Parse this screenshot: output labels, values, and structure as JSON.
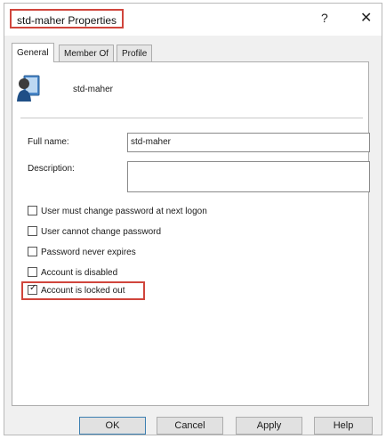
{
  "window": {
    "title": "std-maher Properties",
    "help_glyph": "?",
    "close_glyph": "✕"
  },
  "tabs": [
    {
      "label": "General",
      "active": true
    },
    {
      "label": "Member Of",
      "active": false
    },
    {
      "label": "Profile",
      "active": false
    }
  ],
  "user": {
    "display_name": "std-maher",
    "icon": "user-account-icon"
  },
  "form": {
    "full_name_label": "Full name:",
    "full_name_value": "std-maher",
    "description_label": "Description:",
    "description_value": ""
  },
  "checkboxes": [
    {
      "label": "User must change password at next logon",
      "checked": false
    },
    {
      "label": "User cannot change password",
      "checked": false
    },
    {
      "label": "Password never expires",
      "checked": false
    },
    {
      "label": "Account is disabled",
      "checked": false
    },
    {
      "label": "Account is locked out",
      "checked": true
    }
  ],
  "buttons": {
    "ok": "OK",
    "cancel": "Cancel",
    "apply": "Apply",
    "help": "Help"
  },
  "colors": {
    "highlight": "#d0453c",
    "dialog_bg": "#f0f0f0",
    "panel_bg": "#ffffff"
  }
}
